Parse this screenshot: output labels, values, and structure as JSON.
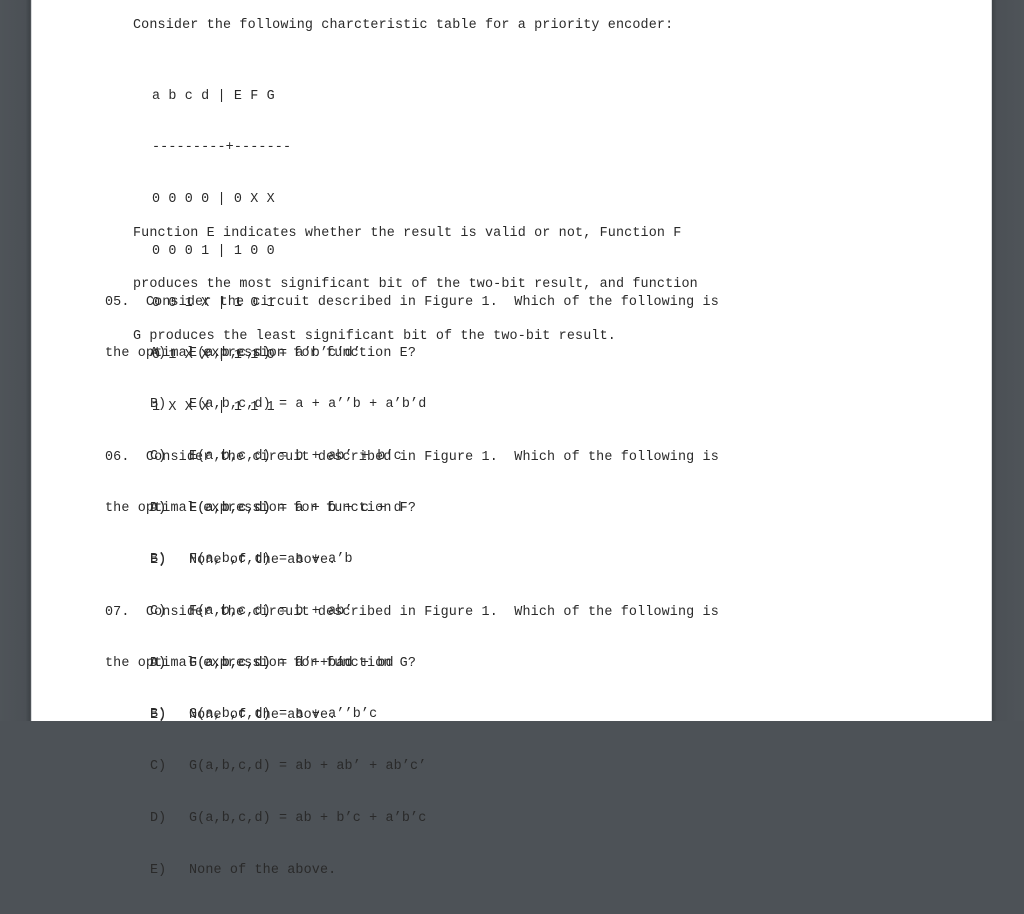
{
  "intro": "Consider the following charcteristic table for a priority encoder:",
  "table": {
    "header": "a b c d | E F G",
    "separator": "---------+-------",
    "rows": [
      "0 0 0 0 | 0 X X",
      "0 0 0 1 | 1 0 0",
      "0 0 1 X | 1 0 1",
      "0 1 X X | 1 1 0",
      "1 X X X | 1 1 1"
    ]
  },
  "description": {
    "lines": [
      "Function E indicates whether the result is valid or not, Function F",
      "produces the most significant bit of the two-bit result, and function",
      "G produces the least significant bit of the two-bit result."
    ]
  },
  "questions": [
    {
      "lines": [
        "05.  Consider the circuit described in Figure 1.  Which of the following is",
        "the optimal expression for function E?"
      ],
      "options": [
        {
          "letter": "A)",
          "text": "E(a,b,c,d) = a’b’c’d’"
        },
        {
          "letter": "B)",
          "text": "E(a,b,c,d) = a + a’’b + a’b’d"
        },
        {
          "letter": "C)",
          "text": "E(a,b,c,d) = b + ab’ + b’c"
        },
        {
          "letter": "D)",
          "text": "E(a,b,c,d) = a + b + c + d"
        },
        {
          "letter": "E)",
          "text": "None of the above."
        }
      ]
    },
    {
      "lines": [
        "06.  Consider the circuit described in Figure 1.  Which of the following is",
        "the optimal expression for function F?"
      ],
      "options": [
        {
          "letter": "A)",
          "text": "F(a,b,c,d) = a + c"
        },
        {
          "letter": "B)",
          "text": "F(a,b,c,d) = a + a’b"
        },
        {
          "letter": "C)",
          "text": "F(a,b,c,d) = b + ab’"
        },
        {
          "letter": "D)",
          "text": "F(a,b,c,d) = d’ + ad + bd"
        },
        {
          "letter": "E)",
          "text": "None of the above."
        }
      ]
    },
    {
      "lines": [
        "07.  Consider the circuit described in Figure 1.  Which of the following is",
        "the optimal expression for function G?"
      ],
      "options": [
        {
          "letter": "A)",
          "text": "G(a,b,c,d) = a + b’c"
        },
        {
          "letter": "B)",
          "text": "G(a,b,c,d) = a + a’’b’c"
        },
        {
          "letter": "C)",
          "text": "G(a,b,c,d) = ab + ab’ + ab’c’"
        },
        {
          "letter": "D)",
          "text": "G(a,b,c,d) = ab + b’c + a’b’c"
        },
        {
          "letter": "E)",
          "text": "None of the above."
        }
      ]
    }
  ]
}
